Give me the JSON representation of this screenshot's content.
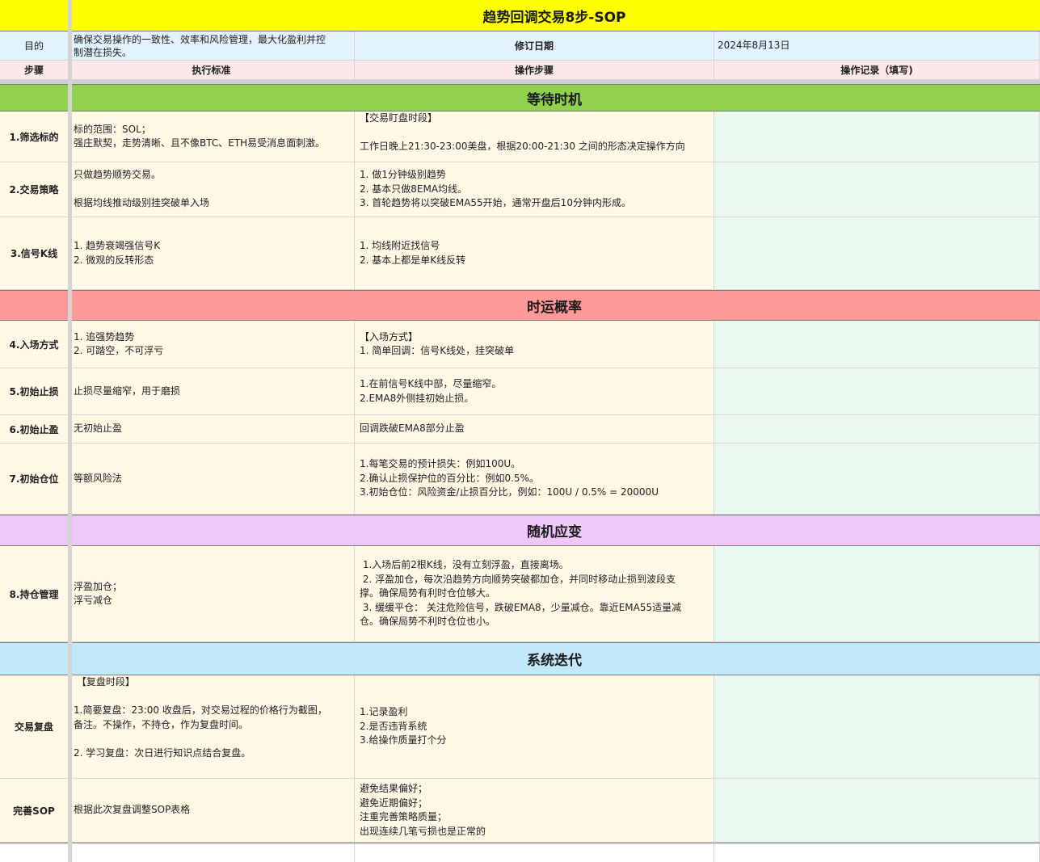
{
  "sheet": {
    "title": "趋势回调交易8步-SOP",
    "purpose_label": "目的",
    "purpose_text": "确保交易操作的一致性、效率和风险管理，最大化盈利并控\n制潜在损失。",
    "revision_label": "修订日期",
    "revision_date": "2024年8月13日",
    "headers": {
      "step": "步骤",
      "standard": "执行标准",
      "operation": "操作步骤",
      "record": "操作记录（填写)"
    },
    "sections": [
      {
        "title": "等待时机",
        "color": "#92d050"
      },
      {
        "title": "时运概率",
        "color": "#ff9999"
      },
      {
        "title": "随机应变",
        "color": "#f0c8f8"
      },
      {
        "title": "系统迭代",
        "color": "#c4e8fb"
      }
    ],
    "rows": [
      {
        "step": "1.筛选标的",
        "standard": "标的范围：SOL；\n强庄默契，走势清晰、且不像BTC、ETH易受消息面刺激。",
        "operation": "【交易盯盘时段】\n\n工作日晚上21:30-23:00美盘，根据20:00-21:30 之间的形态决定操作方向",
        "record": ""
      },
      {
        "step": "2.交易策略",
        "standard": "只做趋势顺势交易。\n\n根据均线推动级别挂突破单入场",
        "operation": "1. 做1分钟级别趋势\n2. 基本只做8EMA均线。\n3. 首轮趋势将以突破EMA55开始，通常开盘后10分钟内形成。",
        "record": ""
      },
      {
        "step": "3.信号K线",
        "standard": "1. 趋势衰竭强信号K\n2. 微观的反转形态",
        "operation": "1. 均线附近找信号\n2. 基本上都是单K线反转",
        "record": ""
      },
      {
        "step": "4.入场方式",
        "standard": "1. 追强势趋势\n2. 可踏空，不可浮亏",
        "operation": "【入场方式】\n1. 简单回调：信号K线处，挂突破单",
        "record": ""
      },
      {
        "step": "5.初始止损",
        "standard": "止损尽量缩窄，用于磨损",
        "operation": "1.在前信号K线中部，尽量缩窄。\n2.EMA8外侧挂初始止损。",
        "record": ""
      },
      {
        "step": "6.初始止盈",
        "standard": "无初始止盈",
        "operation": "回调跌破EMA8部分止盈",
        "record": ""
      },
      {
        "step": "7.初始仓位",
        "standard": "等额风险法",
        "operation": "1.每笔交易的预计损失：例如100U。\n2.确认止损保护位的百分比：例如0.5%。\n3.初始仓位：风险资金/止损百分比，例如：100U / 0.5% = 20000U",
        "record": ""
      },
      {
        "step": "8.持仓管理",
        "standard": "浮盈加仓；\n浮亏减仓",
        "operation": " 1.入场后前2根K线，没有立刻浮盈，直接离场。\n 2. 浮盈加仓，每次沿趋势方向顺势突破都加仓，并同时移动止损到波段支\n撑。确保局势有利时仓位够大。\n 3. 缓缓平仓： 关注危险信号，跌破EMA8，少量减仓。靠近EMA55适量减\n仓。确保局势不利时仓位也小。",
        "record": ""
      },
      {
        "step": "交易复盘",
        "standard": " 【复盘时段】\n\n1.简要复盘：23:00 收盘后，对交易过程的价格行为截图，\n备注。不操作，不持仓，作为复盘时间。\n\n2. 学习复盘：次日进行知识点结合复盘。",
        "operation": "1.记录盈利\n2.是否违背系统\n3.给操作质量打个分",
        "record": ""
      },
      {
        "step": "完善SOP",
        "standard": "根据此次复盘调整SOP表格",
        "operation": "避免结果偏好；\n避免近期偏好；\n注重完善策略质量；\n出现连续几笔亏损也是正常的",
        "record": ""
      }
    ]
  },
  "colors": {
    "title_bg": "#ffff00",
    "header_blue": "#e2f3fd",
    "header_pink": "#fde7e9",
    "content_cream": "#fff8e5",
    "record_mint": "#eaf9ef"
  }
}
